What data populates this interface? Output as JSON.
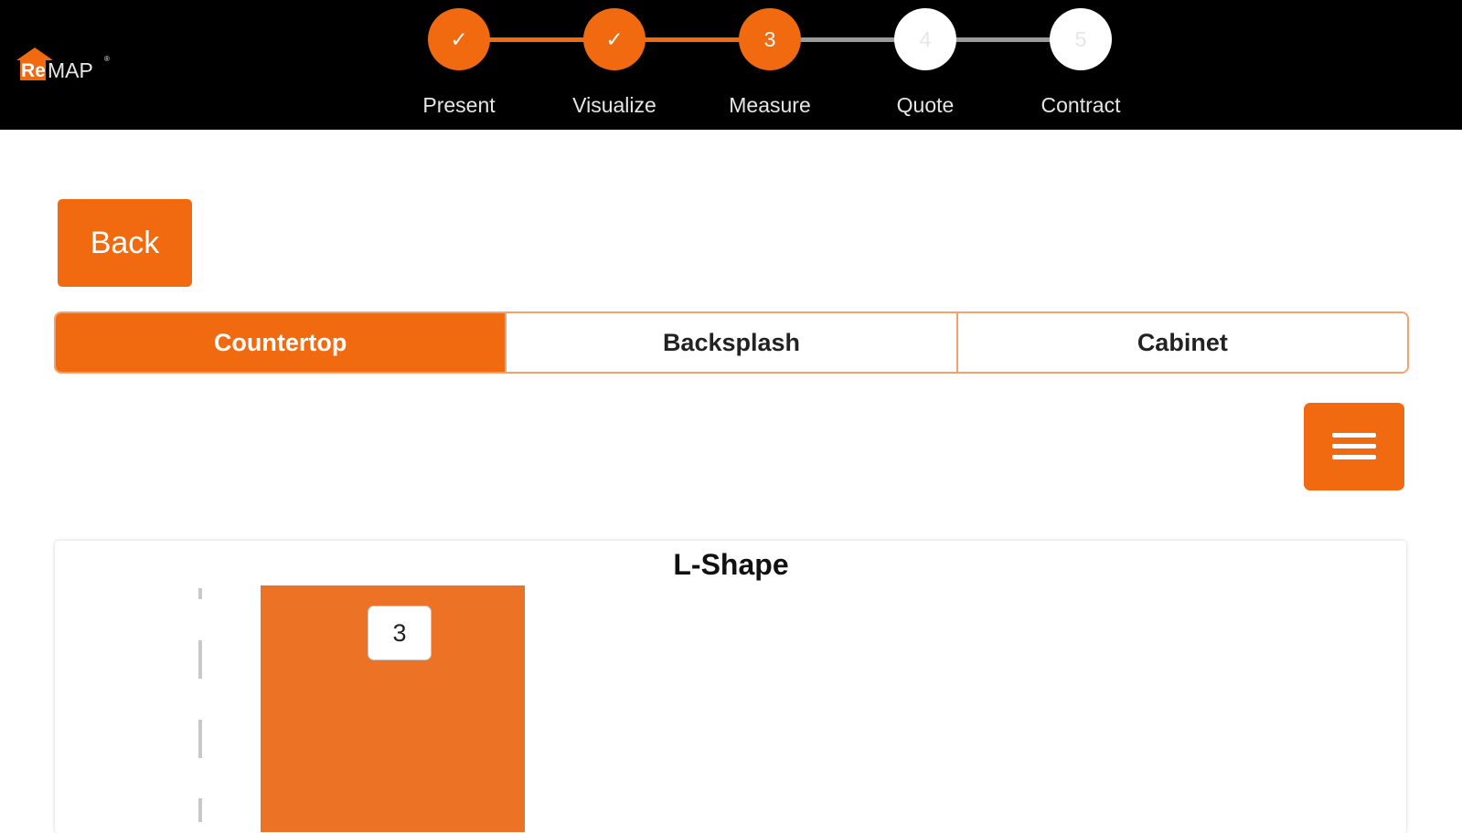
{
  "app": {
    "logo_re": "Re",
    "logo_map": "MAP",
    "logo_reg": "®"
  },
  "steps": [
    {
      "label": "Present",
      "marker": "✓",
      "state": "done"
    },
    {
      "label": "Visualize",
      "marker": "✓",
      "state": "done"
    },
    {
      "label": "Measure",
      "marker": "3",
      "state": "active"
    },
    {
      "label": "Quote",
      "marker": "4",
      "state": "todo"
    },
    {
      "label": "Contract",
      "marker": "5",
      "state": "todo"
    }
  ],
  "back_label": "Back",
  "tabs": [
    {
      "label": "Countertop",
      "active": true
    },
    {
      "label": "Backsplash",
      "active": false
    },
    {
      "label": "Cabinet",
      "active": false
    }
  ],
  "menu_icon": "hamburger-menu-icon",
  "drawing": {
    "title": "L-Shape",
    "segment_label": "3"
  },
  "colors": {
    "accent": "#f26a10",
    "shape_fill": "#ec7226",
    "header_bg": "#000000"
  }
}
